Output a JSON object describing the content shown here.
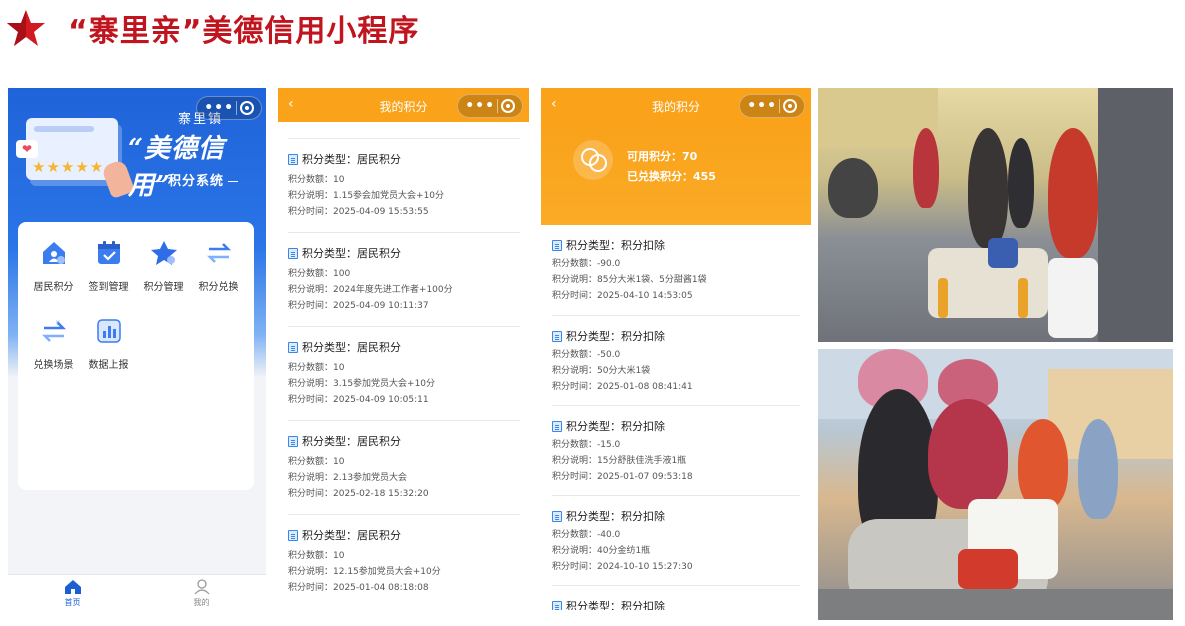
{
  "header": {
    "title": "“寨里亲”美德信用小程序"
  },
  "home": {
    "banner_town": "寨里镇",
    "banner_brand": "“美德信用”",
    "banner_subtitle": "积分系统",
    "menu": [
      {
        "label": "居民积分",
        "icon": "home-people-icon"
      },
      {
        "label": "签到管理",
        "icon": "calendar-check-icon"
      },
      {
        "label": "积分管理",
        "icon": "star-icon"
      },
      {
        "label": "积分兑换",
        "icon": "exchange-icon"
      },
      {
        "label": "兑换场景",
        "icon": "exchange-scene-icon"
      },
      {
        "label": "数据上报",
        "icon": "chart-report-icon"
      }
    ],
    "tabs": [
      {
        "label": "首页",
        "icon": "home-icon"
      },
      {
        "label": "我的",
        "icon": "user-icon"
      }
    ]
  },
  "points_page": {
    "nav_title": "我的积分",
    "records": [
      {
        "type": "积分类型：居民积分",
        "amount": "积分数额：10",
        "note": "积分说明：1.15参会加党员大会+10分",
        "time": "积分时间：2025-04-09 15:53:55"
      },
      {
        "type": "积分类型：居民积分",
        "amount": "积分数额：100",
        "note": "积分说明：2024年度先进工作者+100分",
        "time": "积分时间：2025-04-09 10:11:37"
      },
      {
        "type": "积分类型：居民积分",
        "amount": "积分数额：10",
        "note": "积分说明：3.15参加党员大会+10分",
        "time": "积分时间：2025-04-09 10:05:11"
      },
      {
        "type": "积分类型：居民积分",
        "amount": "积分数额：10",
        "note": "积分说明：2.13参加党员大会",
        "time": "积分时间：2025-02-18 15:32:20"
      },
      {
        "type": "积分类型：居民积分",
        "amount": "积分数额：10",
        "note": "积分说明：12.15参加党员大会+10分",
        "time": "积分时间：2025-01-04 08:18:08"
      }
    ]
  },
  "deduct_page": {
    "nav_title": "我的积分",
    "available": "可用积分：70",
    "redeemed": "已兑换积分：455",
    "records": [
      {
        "type": "积分类型：积分扣除",
        "amount": "积分数额：-90.0",
        "note": "积分说明：85分大米1袋、5分甜酱1袋",
        "time": "积分时间：2025-04-10 14:53:05"
      },
      {
        "type": "积分类型：积分扣除",
        "amount": "积分数额：-50.0",
        "note": "积分说明：50分大米1袋",
        "time": "积分时间：2025-01-08 08:41:41"
      },
      {
        "type": "积分类型：积分扣除",
        "amount": "积分数额：-15.0",
        "note": "积分说明：15分舒肤佳洗手液1瓶",
        "time": "积分时间：2025-01-07 09:53:18"
      },
      {
        "type": "积分类型：积分扣除",
        "amount": "积分数额：-40.0",
        "note": "积分说明：40分金纺1瓶",
        "time": "积分时间：2024-10-10 15:27:30"
      },
      {
        "type": "积分类型：积分扣除"
      }
    ]
  },
  "colors": {
    "title_red": "#c0141e",
    "brand_blue": "#1f63d8",
    "nav_orange": "#f9a21a"
  }
}
